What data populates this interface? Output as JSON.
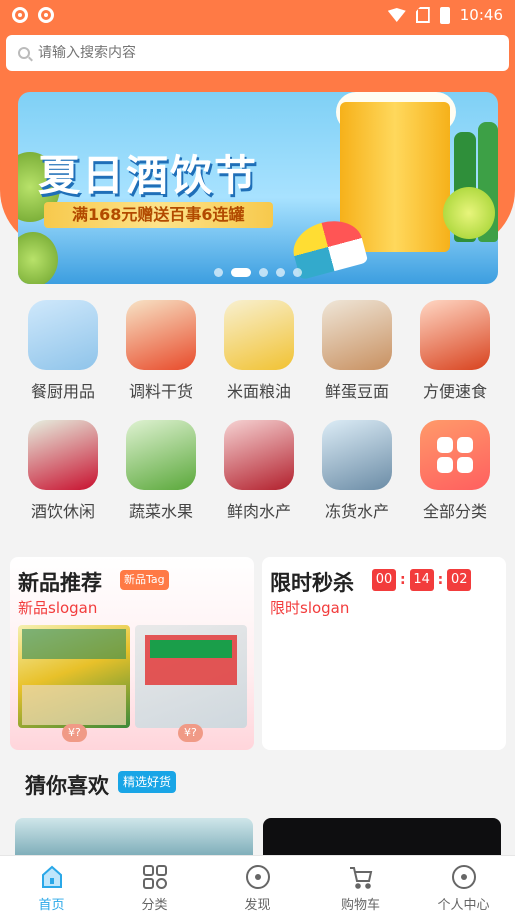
{
  "status_bar": {
    "time": "10:46"
  },
  "search": {
    "placeholder": "请输入搜索内容"
  },
  "banner": {
    "title": "夏日酒饮节",
    "subtitle": "满168元赠送百事6连罐",
    "dot_count": 5,
    "active_dot": 1
  },
  "categories": [
    {
      "label": "餐厨用品",
      "icon": "kitchen-icon",
      "color": "#cfe8fb"
    },
    {
      "label": "调料干货",
      "icon": "seasoning-icon",
      "color": "#f7e3c6"
    },
    {
      "label": "米面粮油",
      "icon": "grain-oil-icon",
      "color": "#f8f0d0"
    },
    {
      "label": "鲜蛋豆面",
      "icon": "egg-icon",
      "color": "#efe6d8"
    },
    {
      "label": "方便速食",
      "icon": "instant-food-icon",
      "color": "#ffd7c4"
    },
    {
      "label": "酒饮休闲",
      "icon": "drink-icon",
      "color": "#e6f0e0"
    },
    {
      "label": "蔬菜水果",
      "icon": "vegetable-icon",
      "color": "#dff2d2"
    },
    {
      "label": "鲜肉水产",
      "icon": "meat-icon",
      "color": "#f6d3d3"
    },
    {
      "label": "冻货水产",
      "icon": "frozen-fish-icon",
      "color": "#dcecf6"
    },
    {
      "label": "全部分类",
      "icon": "all-categories-icon",
      "color": "#ff7a5a"
    }
  ],
  "new_products": {
    "title": "新品推荐",
    "tag": "新品Tag",
    "slogan": "新品slogan",
    "items": [
      {
        "price": "¥?",
        "image": "corn-product-image"
      },
      {
        "price": "¥?",
        "image": "noodle-product-image"
      }
    ]
  },
  "flash_sale": {
    "title": "限时秒杀",
    "slogan": "限时slogan",
    "hours": "00",
    "minutes": "14",
    "seconds": "02"
  },
  "guess": {
    "title": "猜你喜欢",
    "tag": "精选好货"
  },
  "tabs": [
    {
      "label": "首页",
      "icon": "home-icon",
      "active": true
    },
    {
      "label": "分类",
      "icon": "category-icon",
      "active": false
    },
    {
      "label": "发现",
      "icon": "discover-icon",
      "active": false
    },
    {
      "label": "购物车",
      "icon": "cart-icon",
      "active": false
    },
    {
      "label": "个人中心",
      "icon": "profile-icon",
      "active": false
    }
  ],
  "colors": {
    "accent": "#ff7a45",
    "price_red": "#f23c3c",
    "tab_active": "#2aa8e8"
  }
}
